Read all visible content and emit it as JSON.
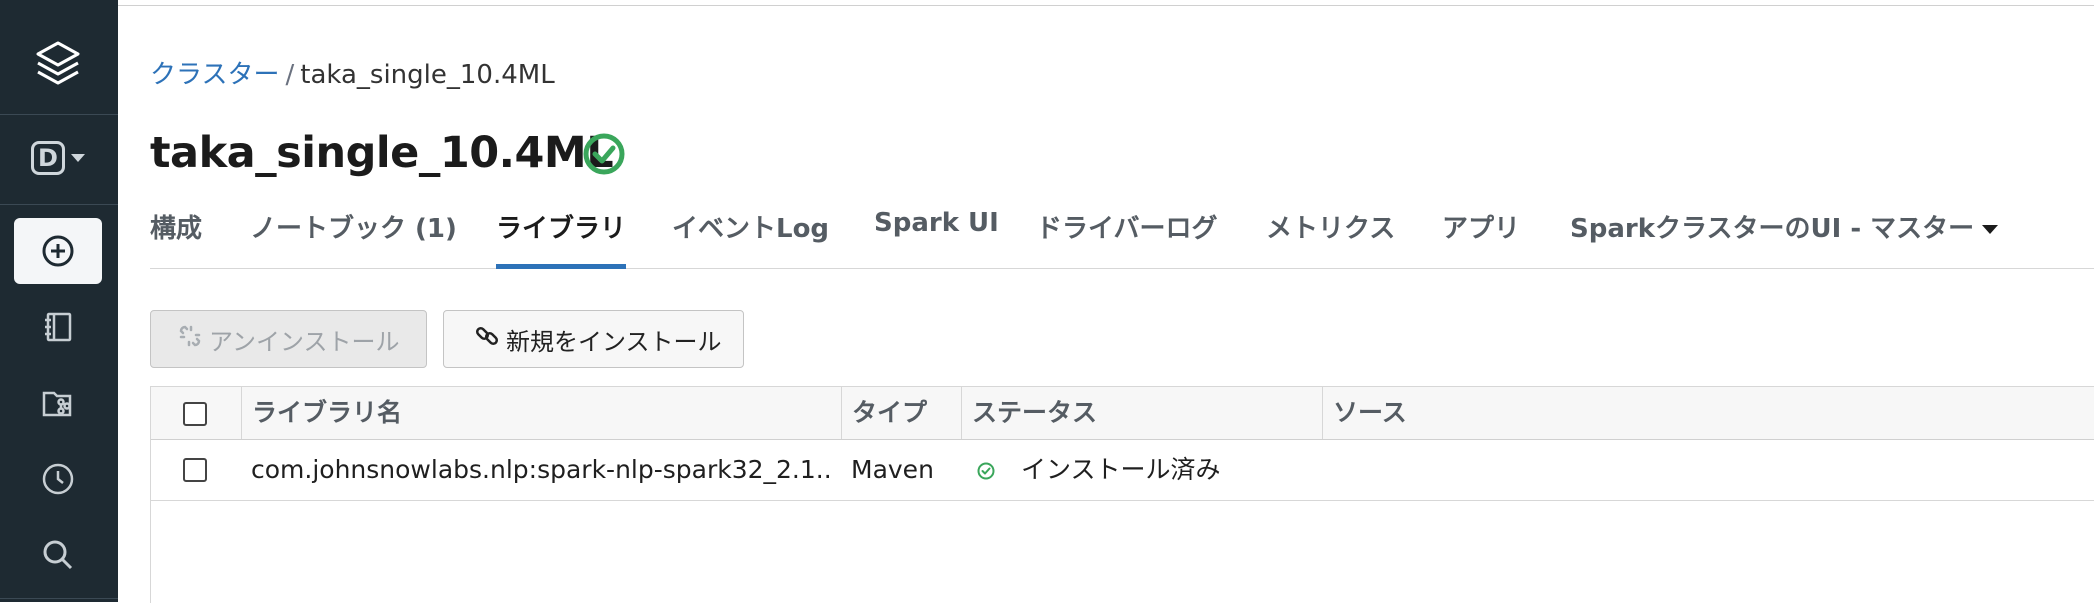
{
  "colors": {
    "sidebar_bg": "#1e2a32",
    "accent": "#2d72b8",
    "success": "#3aa65b"
  },
  "sidebar": {
    "items": [
      {
        "icon": "layers-icon"
      },
      {
        "icon": "workspace-d-icon",
        "letter": "D"
      },
      {
        "icon": "create-plus-icon",
        "active": true
      },
      {
        "icon": "notebook-icon"
      },
      {
        "icon": "repos-icon"
      },
      {
        "icon": "history-clock-icon"
      },
      {
        "icon": "search-icon"
      }
    ]
  },
  "breadcrumb": {
    "parent": "クラスター",
    "separator": "/",
    "current": "taka_single_10.4ML"
  },
  "page": {
    "title": "taka_single_10.4ML",
    "status_icon": "check-circle-icon"
  },
  "tabs": [
    {
      "label": "構成"
    },
    {
      "label": "ノートブック (1)"
    },
    {
      "label": "ライブラリ",
      "active": true
    },
    {
      "label": "イベントLog"
    },
    {
      "label": "Spark UI"
    },
    {
      "label": "ドライバーログ"
    },
    {
      "label": "メトリクス"
    },
    {
      "label": "アプリ"
    },
    {
      "label": "SparkクラスターのUI - マスター",
      "dropdown": true
    }
  ],
  "toolbar": {
    "uninstall_label": "アンインストール",
    "install_label": "新規をインストール"
  },
  "table": {
    "columns": [
      "ライブラリ名",
      "タイプ",
      "ステータス",
      "ソース"
    ],
    "rows": [
      {
        "name": "com.johnsnowlabs.nlp:spark-nlp-spark32_2.1...",
        "type": "Maven",
        "status": "インストール済み",
        "source": ""
      }
    ]
  }
}
